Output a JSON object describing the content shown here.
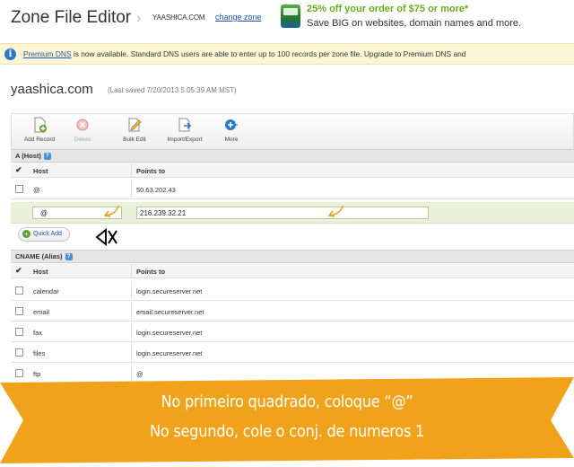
{
  "header": {
    "app_title": "Zone File Editor",
    "domain_small": "YAASHICA.COM",
    "change_zone": "change zone",
    "promo_line1": "25% off your order of $75 or more*",
    "promo_line2": "Save BIG on websites, domain names and more."
  },
  "info_bar": {
    "link_text": "Premium DNS",
    "message": " is now available. Standard DNS users are able to enter up to 100 records per zone file. Upgrade to Premium DNS and"
  },
  "zone": {
    "domain": "yaashica.com",
    "last_saved": "(Last saved 7/20/2013 5:05:39 AM MST)"
  },
  "toolbar": {
    "buttons": [
      {
        "label": "Add Record",
        "icon": "add-record-icon"
      },
      {
        "label": "Delete",
        "icon": "delete-icon"
      },
      {
        "label": "Bulk Edit",
        "icon": "bulk-edit-icon"
      },
      {
        "label": "Import/Export",
        "icon": "import-export-icon"
      },
      {
        "label": "More",
        "icon": "more-icon"
      }
    ]
  },
  "a_section": {
    "title": "A (Host)",
    "col_host": "Host",
    "col_points": "Points to",
    "rows": [
      {
        "host": "@",
        "points": "50.63.202.43"
      }
    ],
    "edit_row": {
      "host": "@",
      "points": "216.239.32.21"
    }
  },
  "quick_add": "Quick Add",
  "cname_section": {
    "title": "CNAME (Alias)",
    "col_host": "Host",
    "col_points": "Points to",
    "rows": [
      {
        "host": "calendar",
        "points": "login.secureserver.net"
      },
      {
        "host": "email",
        "points": "email.secureserver.net"
      },
      {
        "host": "fax",
        "points": "login.secureserver.net"
      },
      {
        "host": "files",
        "points": "login.secureserver.net"
      },
      {
        "host": "ftp",
        "points": "@"
      }
    ]
  },
  "banner": {
    "line1": "No primeiro quadrado, coloque “@”",
    "line2": "No segundo, cole o conj. de numeros 1",
    "color": "#f0a31a"
  },
  "colors": {
    "link": "#2255aa",
    "promo_green": "#6aaa1e",
    "info_bg": "#fdf6d6",
    "edit_row_bg": "#e9f1d8"
  }
}
